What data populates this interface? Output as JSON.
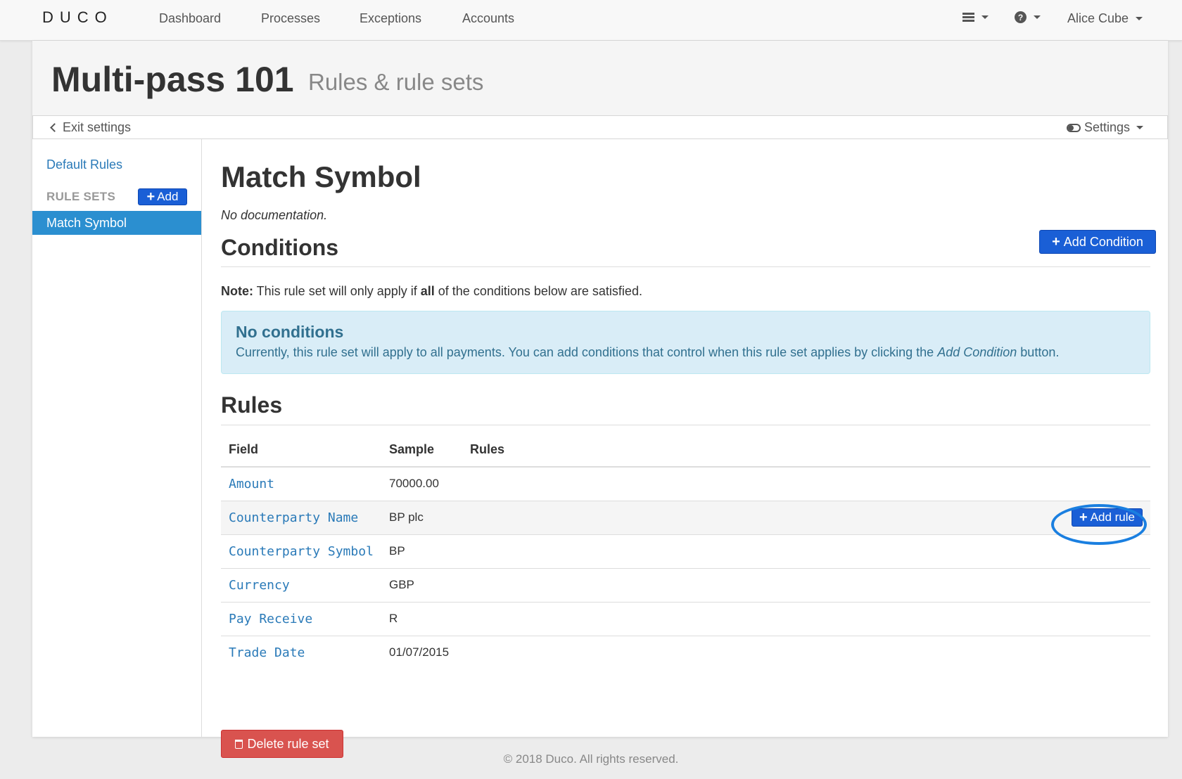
{
  "nav": {
    "logo": "DUCO",
    "links": [
      "Dashboard",
      "Processes",
      "Exceptions",
      "Accounts"
    ],
    "user": "Alice Cube",
    "menu_icon": "hamburger-icon",
    "help_icon": "question-circle-icon"
  },
  "header": {
    "title": "Multi-pass 101",
    "subtitle": "Rules & rule sets"
  },
  "settings_bar": {
    "exit_label": "Exit settings",
    "settings_label": "Settings"
  },
  "sidebar": {
    "default_rules": "Default Rules",
    "heading": "RULE SETS",
    "add_label": "Add",
    "active_item": "Match Symbol"
  },
  "main": {
    "title": "Match Symbol",
    "documentation": "No documentation.",
    "conditions": {
      "heading": "Conditions",
      "add_button": "Add Condition",
      "note_label": "Note:",
      "note_pre": " This rule set will only apply if ",
      "note_bold": "all",
      "note_post": " of the conditions below are satisfied.",
      "alert_title": "No conditions",
      "alert_pre": "Currently, this rule set will apply to all payments. You can add conditions that control when this rule set applies by clicking the ",
      "alert_em": "Add Condition",
      "alert_post": " button."
    },
    "rules": {
      "heading": "Rules",
      "columns": [
        "Field",
        "Sample",
        "Rules"
      ],
      "rows": [
        {
          "field": "Amount",
          "sample": "70000.00"
        },
        {
          "field": "Counterparty Name",
          "sample": "BP plc",
          "action": "Add rule"
        },
        {
          "field": "Counterparty Symbol",
          "sample": "BP"
        },
        {
          "field": "Currency",
          "sample": "GBP"
        },
        {
          "field": "Pay Receive",
          "sample": "R"
        },
        {
          "field": "Trade Date",
          "sample": "01/07/2015"
        }
      ]
    },
    "delete_button": "Delete rule set"
  },
  "footer": "© 2018 Duco. All rights reserved.",
  "colors": {
    "primary": "#1a5fd6",
    "link": "#2a7ab8",
    "active": "#2b8fd0",
    "danger": "#d9534f",
    "info_bg": "#d9edf7",
    "info_text": "#31708f"
  }
}
